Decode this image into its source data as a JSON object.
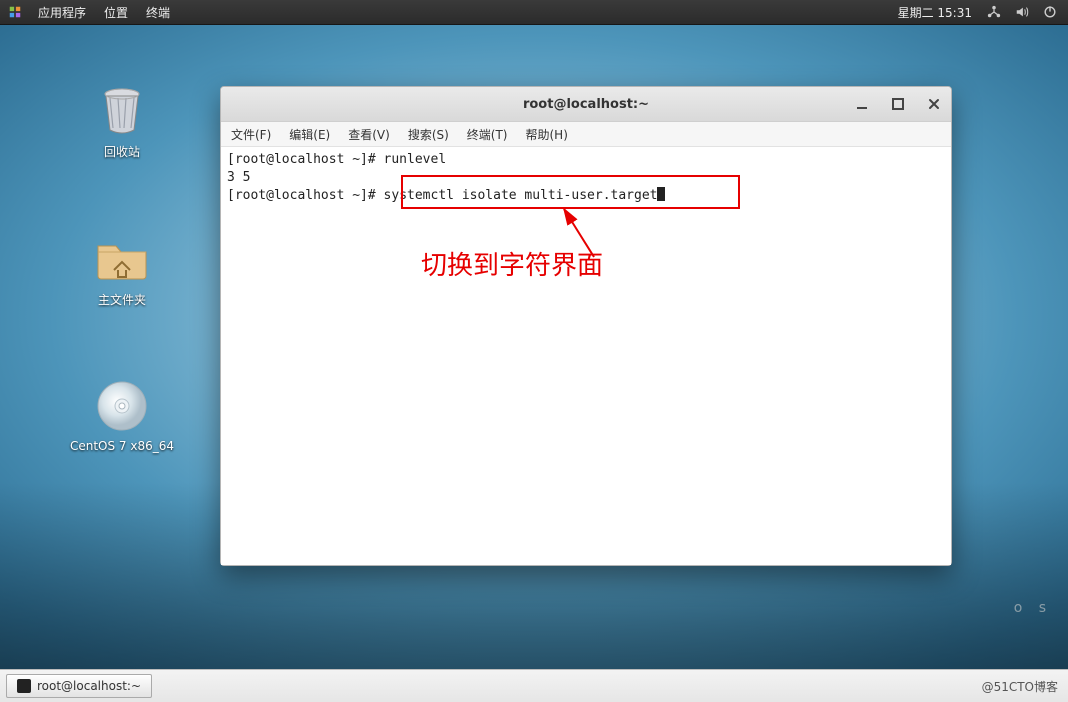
{
  "panel": {
    "apps_label": "应用程序",
    "places_label": "位置",
    "terminal_label": "终端",
    "clock": "星期二  15:31"
  },
  "desktop_icons": {
    "trash": "回收站",
    "home": "主文件夹",
    "disc": "CentOS 7 x86_64"
  },
  "desktop_brand_text": "o s",
  "window": {
    "title": "root@localhost:~",
    "menus": {
      "file": "文件(F)",
      "edit": "编辑(E)",
      "view": "查看(V)",
      "search": "搜索(S)",
      "terminal": "终端(T)",
      "help": "帮助(H)"
    },
    "terminal_lines": {
      "l1": "[root@localhost ~]# runlevel",
      "l2": "3 5",
      "l3_prompt": "[root@localhost ~]# ",
      "l3_cmd": "systemctl isolate multi-user.target"
    },
    "annotation": "切换到字符界面"
  },
  "taskbar": {
    "item1": "root@localhost:~",
    "watermark": "@51CTO博客"
  }
}
